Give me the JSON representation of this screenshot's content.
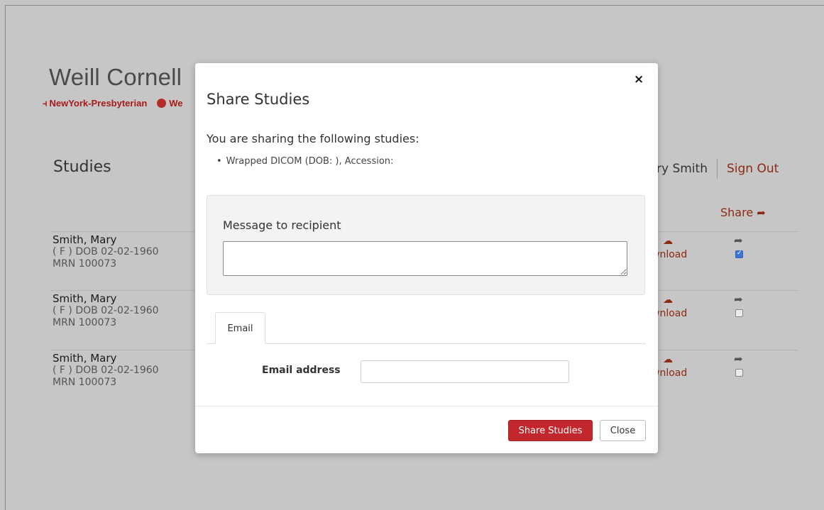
{
  "background": {
    "brand_title": "Weill Cornell",
    "brand_sub_nyp": "NewYork-Presbyterian",
    "brand_sub_cut": "We",
    "page_title": "Studies",
    "user_name": "ry Smith",
    "sign_out": "Sign Out",
    "share_header": "Share",
    "rows": [
      {
        "name": "Smith, Mary",
        "line2": "( F ) DOB 02-02-1960",
        "line3": "MRN 100073",
        "download": "wnload",
        "checked": true
      },
      {
        "name": "Smith, Mary",
        "line2": "( F ) DOB 02-02-1960",
        "line3": "MRN 100073",
        "download": "wnload",
        "checked": false
      },
      {
        "name": "Smith, Mary",
        "line2": "( F ) DOB 02-02-1960",
        "line3": "MRN 100073",
        "download": "wnload",
        "checked": false
      }
    ]
  },
  "modal": {
    "close_symbol": "×",
    "title": "Share Studies",
    "sharing_text": "You are sharing the following studies:",
    "study_item": "Wrapped DICOM (DOB: ), Accession:",
    "message_label": "Message to recipient",
    "message_value": "",
    "tab_email": "Email",
    "email_label": "Email address",
    "email_value": "",
    "share_button": "Share Studies",
    "close_button": "Close"
  },
  "colors": {
    "overlay": "#c6c6c6",
    "brand_red": "#a81a1a",
    "link_brown": "#8c2a12",
    "primary_button": "#c1272d",
    "checkbox_checked": "#3a76d8"
  }
}
